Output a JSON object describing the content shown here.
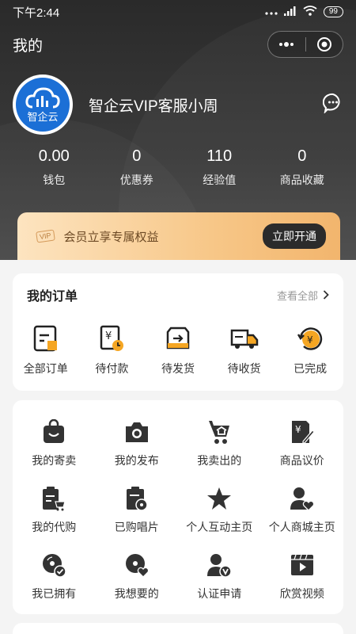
{
  "status_bar": {
    "time": "下午2:44",
    "battery": "99"
  },
  "nav": {
    "title": "我的"
  },
  "profile": {
    "logo_text": "智企云",
    "name": "智企云VIP客服小周"
  },
  "stats": [
    {
      "value": "0.00",
      "label": "钱包"
    },
    {
      "value": "0",
      "label": "优惠券"
    },
    {
      "value": "110",
      "label": "经验值"
    },
    {
      "value": "0",
      "label": "商品收藏"
    }
  ],
  "vip": {
    "badge": "VIP",
    "text": "会员立享专属权益",
    "button": "立即开通"
  },
  "orders": {
    "title": "我的订单",
    "see_all": "查看全部",
    "items": [
      {
        "label": "全部订单",
        "icon": "all-orders-icon"
      },
      {
        "label": "待付款",
        "icon": "pending-payment-icon"
      },
      {
        "label": "待发货",
        "icon": "pending-shipment-icon"
      },
      {
        "label": "待收货",
        "icon": "pending-receipt-icon"
      },
      {
        "label": "已完成",
        "icon": "completed-icon"
      }
    ]
  },
  "services": [
    {
      "label": "我的寄卖",
      "icon": "bag-icon"
    },
    {
      "label": "我的发布",
      "icon": "camera-icon"
    },
    {
      "label": "我卖出的",
      "icon": "cart-icon"
    },
    {
      "label": "商品议价",
      "icon": "price-edit-icon"
    },
    {
      "label": "我的代购",
      "icon": "clipboard-cart-icon"
    },
    {
      "label": "已购唱片",
      "icon": "record-list-icon"
    },
    {
      "label": "个人互动主页",
      "icon": "star-icon"
    },
    {
      "label": "个人商城主页",
      "icon": "user-heart-icon"
    },
    {
      "label": "我已拥有",
      "icon": "disc-check-icon"
    },
    {
      "label": "我想要的",
      "icon": "disc-heart-icon"
    },
    {
      "label": "认证申请",
      "icon": "user-verify-icon"
    },
    {
      "label": "欣赏视频",
      "icon": "video-play-icon"
    }
  ],
  "colors": {
    "accent_orange": "#f5a623",
    "dark": "#2b2b2b",
    "brand_blue": "#1b6fd6"
  }
}
